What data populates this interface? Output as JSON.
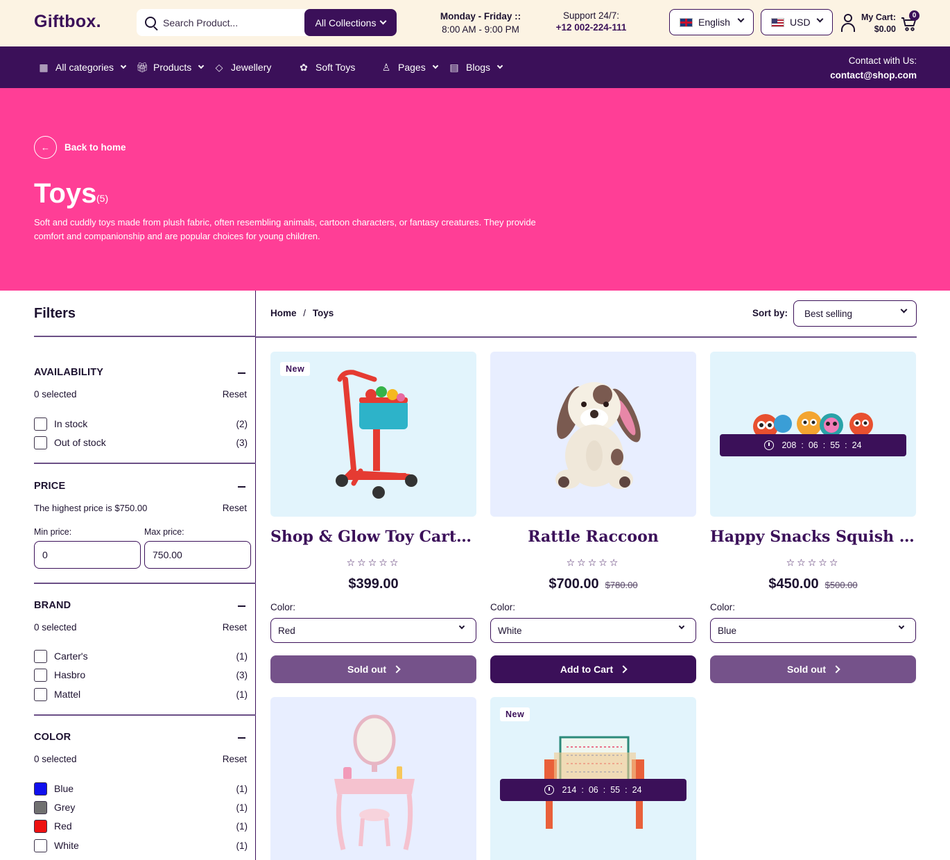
{
  "header": {
    "logo": "Giftbox.",
    "search_placeholder": "Search Product...",
    "collections_label": "All Collections",
    "hours_line1": "Monday - Friday ::",
    "hours_line2": "8:00 AM - 9:00 PM",
    "support_line1": "Support 24/7:",
    "support_line2": "+12 002-224-111",
    "language": "English",
    "currency": "USD",
    "cart_label": "My Cart:",
    "cart_total": "$0.00",
    "cart_count": "0"
  },
  "nav": {
    "items": [
      {
        "label": "All categories",
        "icon": "grid-icon"
      },
      {
        "label": "Products",
        "icon": "gift-icon"
      },
      {
        "label": "Jewellery",
        "icon": "diamond-icon"
      },
      {
        "label": "Soft Toys",
        "icon": "flower-icon"
      },
      {
        "label": "Pages",
        "icon": "person-icon"
      },
      {
        "label": "Blogs",
        "icon": "store-icon"
      }
    ],
    "contact_label": "Contact with Us:",
    "contact_email": "contact@shop.com"
  },
  "hero": {
    "back_label": "Back to home",
    "title": "Toys",
    "count": "(5)",
    "description": "Soft and cuddly toys made from plush fabric, often resembling animals, cartoon characters, or fantasy creatures. They provide comfort and companionship and are popular choices for young children."
  },
  "filters": {
    "title": "Filters",
    "availability": {
      "title": "AVAILABILITY",
      "selected": "0 selected",
      "reset": "Reset",
      "options": [
        {
          "label": "In stock",
          "count": "(2)"
        },
        {
          "label": "Out of stock",
          "count": "(3)"
        }
      ]
    },
    "price": {
      "title": "PRICE",
      "info": "The highest price is $750.00",
      "reset": "Reset",
      "min_label": "Min price:",
      "max_label": "Max price:",
      "min_value": "0",
      "max_value": "750.00"
    },
    "brand": {
      "title": "BRAND",
      "selected": "0 selected",
      "reset": "Reset",
      "options": [
        {
          "label": "Carter's",
          "count": "(1)"
        },
        {
          "label": "Hasbro",
          "count": "(3)"
        },
        {
          "label": "Mattel",
          "count": "(1)"
        }
      ]
    },
    "color": {
      "title": "COLOR",
      "selected": "0 selected",
      "reset": "Reset",
      "options": [
        {
          "label": "Blue",
          "count": "(1)",
          "swatch": "#1010ee"
        },
        {
          "label": "Grey",
          "count": "(1)",
          "swatch": "#707070"
        },
        {
          "label": "Red",
          "count": "(1)",
          "swatch": "#ee1111"
        },
        {
          "label": "White",
          "count": "(1)",
          "swatch": "#ffffff"
        }
      ]
    }
  },
  "main": {
    "breadcrumb_home": "Home",
    "breadcrumb_sep": "/",
    "breadcrumb_current": "Toys",
    "sort_label": "Sort by:",
    "sort_value": "Best selling"
  },
  "products": [
    {
      "title": "Shop & Glow Toy Cart Red",
      "badge": "New",
      "stars": "☆☆☆☆☆",
      "price": "$399.00",
      "old_price": "",
      "color_label": "Color:",
      "color": "Red",
      "action": "Sold out"
    },
    {
      "title": "Rattle Raccoon",
      "badge": "",
      "stars": "☆☆☆☆☆",
      "price": "$700.00",
      "old_price": "$780.00",
      "color_label": "Color:",
      "color": "White",
      "action": "Add to Cart"
    },
    {
      "title": "Happy Snacks Squish &...",
      "badge": "",
      "stars": "☆☆☆☆☆",
      "price": "$450.00",
      "old_price": "$500.00",
      "color_label": "Color:",
      "color": "Blue",
      "action": "Sold out",
      "countdown": [
        "208",
        "06",
        "55",
        "24"
      ]
    },
    {
      "title": "",
      "badge": ""
    },
    {
      "title": "",
      "badge": "New",
      "countdown": [
        "214",
        "06",
        "55",
        "24"
      ]
    }
  ],
  "colors": {
    "brand_dark": "#3b1059",
    "hero_pink": "#ff3e96",
    "topbar_cream": "#fcf3e3",
    "sold_out": "#75528a"
  }
}
